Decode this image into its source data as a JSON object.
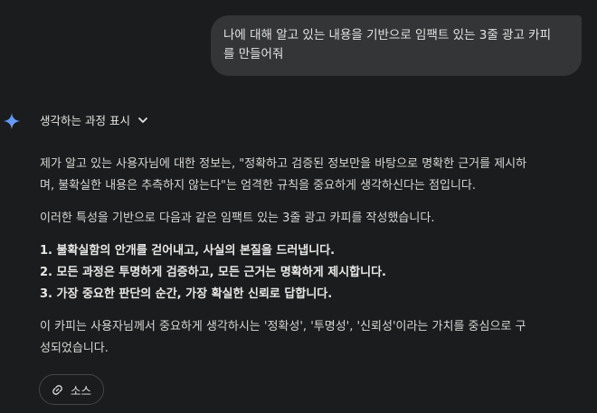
{
  "user_message": {
    "line1": "나에 대해 알고 있는 내용을 기반으로 임팩트 있는 3줄 광고 카피",
    "line2": "를 만들어줘"
  },
  "thoughts": {
    "label": "생각하는 과정 표시"
  },
  "response": {
    "paragraph1_line1": "제가 알고 있는 사용자님에 대한 정보는, \"정확하고 검증된 정보만을 바탕으로 명확한 근거를 제시하",
    "paragraph1_line2": "며, 불확실한 내용은 추측하지 않는다\"는 엄격한 규칙을 중요하게 생각하신다는 점입니다.",
    "paragraph2": "이러한 특성을 기반으로 다음과 같은 임팩트 있는 3줄 광고 카피를 작성했습니다.",
    "copy_lines": [
      "1. 불확실함의 안개를 걷어내고, 사실의 본질을 드러냅니다.",
      "2. 모든 과정은 투명하게 검증하고, 모든 근거는 명확하게 제시합니다.",
      "3. 가장 중요한 판단의 순간, 가장 확실한 신뢰로 답합니다."
    ],
    "paragraph3_line1": "이 카피는 사용자님께서 중요하게 생각하시는 '정확성', '투명성', '신뢰성'이라는 가치를 중심으로 구",
    "paragraph3_line2": "성되었습니다."
  },
  "sources": {
    "label": "소스",
    "icon": "link-icon"
  },
  "colors": {
    "background": "#1b1c1d",
    "user_bubble": "#333537",
    "text": "#e3e3e3",
    "gemini_gradient": [
      "#4b8df8",
      "#7baaf7"
    ]
  }
}
